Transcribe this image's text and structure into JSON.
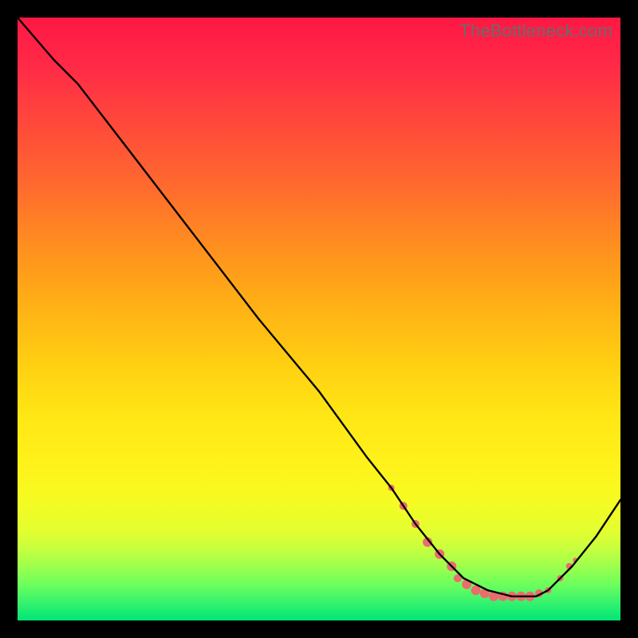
{
  "watermark": "TheBottleneck.com",
  "colors": {
    "dot": "#ec6b6f",
    "line": "#000000",
    "bg": "#000000"
  },
  "chart_data": {
    "type": "line",
    "title": "",
    "xlabel": "",
    "ylabel": "",
    "xlim": [
      0,
      100
    ],
    "ylim": [
      0,
      100
    ],
    "grid": false,
    "series": [
      {
        "name": "curve",
        "x": [
          0,
          6,
          10,
          20,
          30,
          40,
          50,
          58,
          62,
          66,
          70,
          74,
          78,
          82,
          86,
          88,
          92,
          96,
          100
        ],
        "y": [
          100,
          93,
          89,
          76,
          63,
          50,
          38,
          27,
          22,
          16,
          11,
          7,
          5,
          4,
          4,
          5,
          9,
          14,
          20
        ]
      }
    ],
    "dots_note": "coral dots cluster along the trough of the curve, roughly x∈[62,92]",
    "dots": [
      {
        "x": 62,
        "y": 22,
        "r": 4
      },
      {
        "x": 64,
        "y": 19,
        "r": 5
      },
      {
        "x": 66,
        "y": 16,
        "r": 5
      },
      {
        "x": 68,
        "y": 13,
        "r": 6
      },
      {
        "x": 70,
        "y": 11,
        "r": 6
      },
      {
        "x": 72,
        "y": 9,
        "r": 6
      },
      {
        "x": 73,
        "y": 7,
        "r": 5
      },
      {
        "x": 74.5,
        "y": 6,
        "r": 6
      },
      {
        "x": 76,
        "y": 5,
        "r": 6
      },
      {
        "x": 77.5,
        "y": 4.5,
        "r": 6
      },
      {
        "x": 79,
        "y": 4,
        "r": 6
      },
      {
        "x": 80.5,
        "y": 4,
        "r": 6
      },
      {
        "x": 82,
        "y": 4,
        "r": 6
      },
      {
        "x": 83.5,
        "y": 4,
        "r": 6
      },
      {
        "x": 85,
        "y": 4,
        "r": 6
      },
      {
        "x": 86.5,
        "y": 4.5,
        "r": 5
      },
      {
        "x": 88,
        "y": 5,
        "r": 4
      },
      {
        "x": 90,
        "y": 7,
        "r": 4
      },
      {
        "x": 91.5,
        "y": 9,
        "r": 4
      },
      {
        "x": 92.5,
        "y": 10,
        "r": 3
      }
    ]
  }
}
